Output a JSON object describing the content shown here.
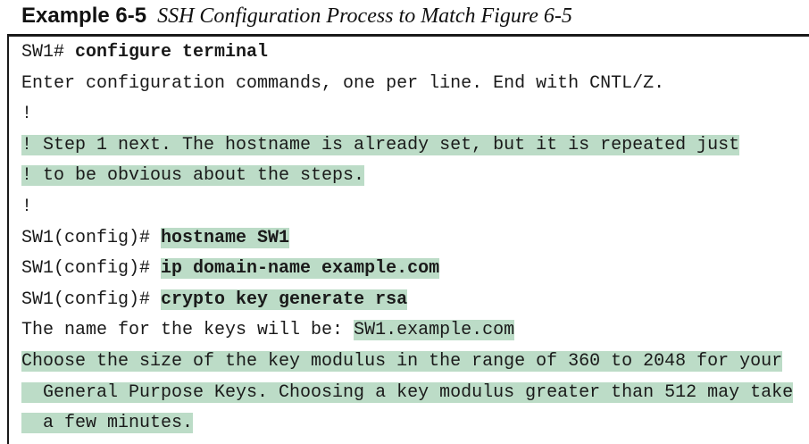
{
  "example": {
    "label": "Example 6-5",
    "title": "SSH Configuration Process to Match Figure 6-5"
  },
  "lines": [
    {
      "prompt": "SW1# ",
      "command": "configure terminal"
    },
    {
      "text": "Enter configuration commands, one per line. End with CNTL/Z."
    },
    {
      "text": "!"
    },
    {
      "text": "! Step 1 next. The hostname is already set, but it is repeated just"
    },
    {
      "text": "! to be obvious about the steps."
    },
    {
      "text": "!"
    },
    {
      "prompt": "SW1(config)# ",
      "command": "hostname SW1"
    },
    {
      "prompt": "SW1(config)# ",
      "command": "ip domain-name example.com"
    },
    {
      "prompt": "SW1(config)# ",
      "command": "crypto key generate rsa"
    },
    {
      "text": "The name for the keys will be: ",
      "value": "SW1.example.com"
    },
    {
      "text": "Choose the size of the key modulus in the range of 360 to 2048 for your"
    },
    {
      "text": "  General Purpose Keys. Choosing a key modulus greater than 512 may take"
    },
    {
      "text": "  a few minutes."
    }
  ],
  "highlight_color": "#bcdcc7"
}
